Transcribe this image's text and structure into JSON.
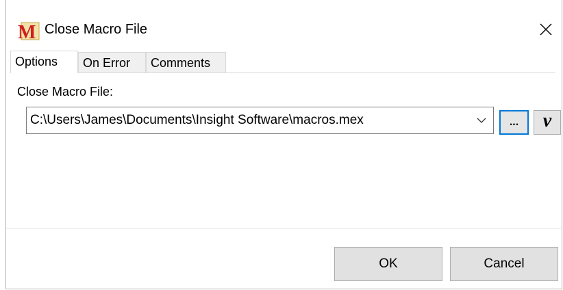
{
  "window": {
    "title": "Close Macro File"
  },
  "tabs": [
    {
      "label": "Options",
      "active": true
    },
    {
      "label": "On Error",
      "active": false
    },
    {
      "label": "Comments",
      "active": false
    }
  ],
  "options": {
    "field_label": "Close Macro File:",
    "file_path": "C:\\Users\\James\\Documents\\Insight Software\\macros.mex",
    "browse_label": "...",
    "variable_label": "v"
  },
  "buttons": {
    "ok": "OK",
    "cancel": "Cancel"
  },
  "icons": {
    "app": "macro-m-icon",
    "close": "close-icon",
    "dropdown": "chevron-down-icon"
  },
  "colors": {
    "app_icon_red": "#d01f1f",
    "focus_border": "#0078d7"
  }
}
